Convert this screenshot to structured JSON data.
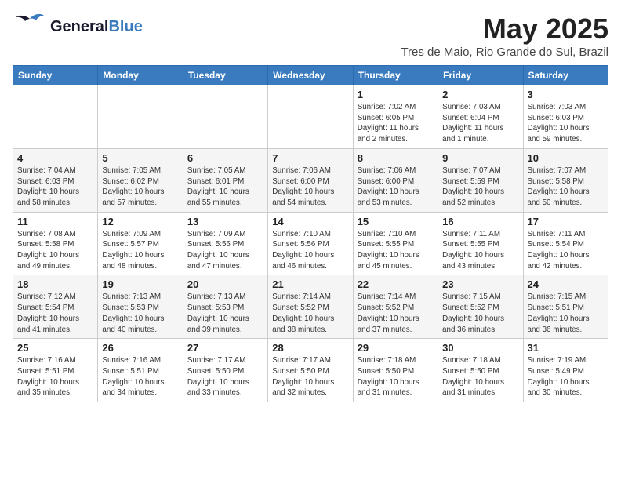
{
  "header": {
    "logo_general": "General",
    "logo_blue": "Blue",
    "month_title": "May 2025",
    "location": "Tres de Maio, Rio Grande do Sul, Brazil"
  },
  "weekdays": [
    "Sunday",
    "Monday",
    "Tuesday",
    "Wednesday",
    "Thursday",
    "Friday",
    "Saturday"
  ],
  "weeks": [
    [
      {
        "num": "",
        "info": ""
      },
      {
        "num": "",
        "info": ""
      },
      {
        "num": "",
        "info": ""
      },
      {
        "num": "",
        "info": ""
      },
      {
        "num": "1",
        "info": "Sunrise: 7:02 AM\nSunset: 6:05 PM\nDaylight: 11 hours\nand 2 minutes."
      },
      {
        "num": "2",
        "info": "Sunrise: 7:03 AM\nSunset: 6:04 PM\nDaylight: 11 hours\nand 1 minute."
      },
      {
        "num": "3",
        "info": "Sunrise: 7:03 AM\nSunset: 6:03 PM\nDaylight: 10 hours\nand 59 minutes."
      }
    ],
    [
      {
        "num": "4",
        "info": "Sunrise: 7:04 AM\nSunset: 6:03 PM\nDaylight: 10 hours\nand 58 minutes."
      },
      {
        "num": "5",
        "info": "Sunrise: 7:05 AM\nSunset: 6:02 PM\nDaylight: 10 hours\nand 57 minutes."
      },
      {
        "num": "6",
        "info": "Sunrise: 7:05 AM\nSunset: 6:01 PM\nDaylight: 10 hours\nand 55 minutes."
      },
      {
        "num": "7",
        "info": "Sunrise: 7:06 AM\nSunset: 6:00 PM\nDaylight: 10 hours\nand 54 minutes."
      },
      {
        "num": "8",
        "info": "Sunrise: 7:06 AM\nSunset: 6:00 PM\nDaylight: 10 hours\nand 53 minutes."
      },
      {
        "num": "9",
        "info": "Sunrise: 7:07 AM\nSunset: 5:59 PM\nDaylight: 10 hours\nand 52 minutes."
      },
      {
        "num": "10",
        "info": "Sunrise: 7:07 AM\nSunset: 5:58 PM\nDaylight: 10 hours\nand 50 minutes."
      }
    ],
    [
      {
        "num": "11",
        "info": "Sunrise: 7:08 AM\nSunset: 5:58 PM\nDaylight: 10 hours\nand 49 minutes."
      },
      {
        "num": "12",
        "info": "Sunrise: 7:09 AM\nSunset: 5:57 PM\nDaylight: 10 hours\nand 48 minutes."
      },
      {
        "num": "13",
        "info": "Sunrise: 7:09 AM\nSunset: 5:56 PM\nDaylight: 10 hours\nand 47 minutes."
      },
      {
        "num": "14",
        "info": "Sunrise: 7:10 AM\nSunset: 5:56 PM\nDaylight: 10 hours\nand 46 minutes."
      },
      {
        "num": "15",
        "info": "Sunrise: 7:10 AM\nSunset: 5:55 PM\nDaylight: 10 hours\nand 45 minutes."
      },
      {
        "num": "16",
        "info": "Sunrise: 7:11 AM\nSunset: 5:55 PM\nDaylight: 10 hours\nand 43 minutes."
      },
      {
        "num": "17",
        "info": "Sunrise: 7:11 AM\nSunset: 5:54 PM\nDaylight: 10 hours\nand 42 minutes."
      }
    ],
    [
      {
        "num": "18",
        "info": "Sunrise: 7:12 AM\nSunset: 5:54 PM\nDaylight: 10 hours\nand 41 minutes."
      },
      {
        "num": "19",
        "info": "Sunrise: 7:13 AM\nSunset: 5:53 PM\nDaylight: 10 hours\nand 40 minutes."
      },
      {
        "num": "20",
        "info": "Sunrise: 7:13 AM\nSunset: 5:53 PM\nDaylight: 10 hours\nand 39 minutes."
      },
      {
        "num": "21",
        "info": "Sunrise: 7:14 AM\nSunset: 5:52 PM\nDaylight: 10 hours\nand 38 minutes."
      },
      {
        "num": "22",
        "info": "Sunrise: 7:14 AM\nSunset: 5:52 PM\nDaylight: 10 hours\nand 37 minutes."
      },
      {
        "num": "23",
        "info": "Sunrise: 7:15 AM\nSunset: 5:52 PM\nDaylight: 10 hours\nand 36 minutes."
      },
      {
        "num": "24",
        "info": "Sunrise: 7:15 AM\nSunset: 5:51 PM\nDaylight: 10 hours\nand 36 minutes."
      }
    ],
    [
      {
        "num": "25",
        "info": "Sunrise: 7:16 AM\nSunset: 5:51 PM\nDaylight: 10 hours\nand 35 minutes."
      },
      {
        "num": "26",
        "info": "Sunrise: 7:16 AM\nSunset: 5:51 PM\nDaylight: 10 hours\nand 34 minutes."
      },
      {
        "num": "27",
        "info": "Sunrise: 7:17 AM\nSunset: 5:50 PM\nDaylight: 10 hours\nand 33 minutes."
      },
      {
        "num": "28",
        "info": "Sunrise: 7:17 AM\nSunset: 5:50 PM\nDaylight: 10 hours\nand 32 minutes."
      },
      {
        "num": "29",
        "info": "Sunrise: 7:18 AM\nSunset: 5:50 PM\nDaylight: 10 hours\nand 31 minutes."
      },
      {
        "num": "30",
        "info": "Sunrise: 7:18 AM\nSunset: 5:50 PM\nDaylight: 10 hours\nand 31 minutes."
      },
      {
        "num": "31",
        "info": "Sunrise: 7:19 AM\nSunset: 5:49 PM\nDaylight: 10 hours\nand 30 minutes."
      }
    ]
  ]
}
